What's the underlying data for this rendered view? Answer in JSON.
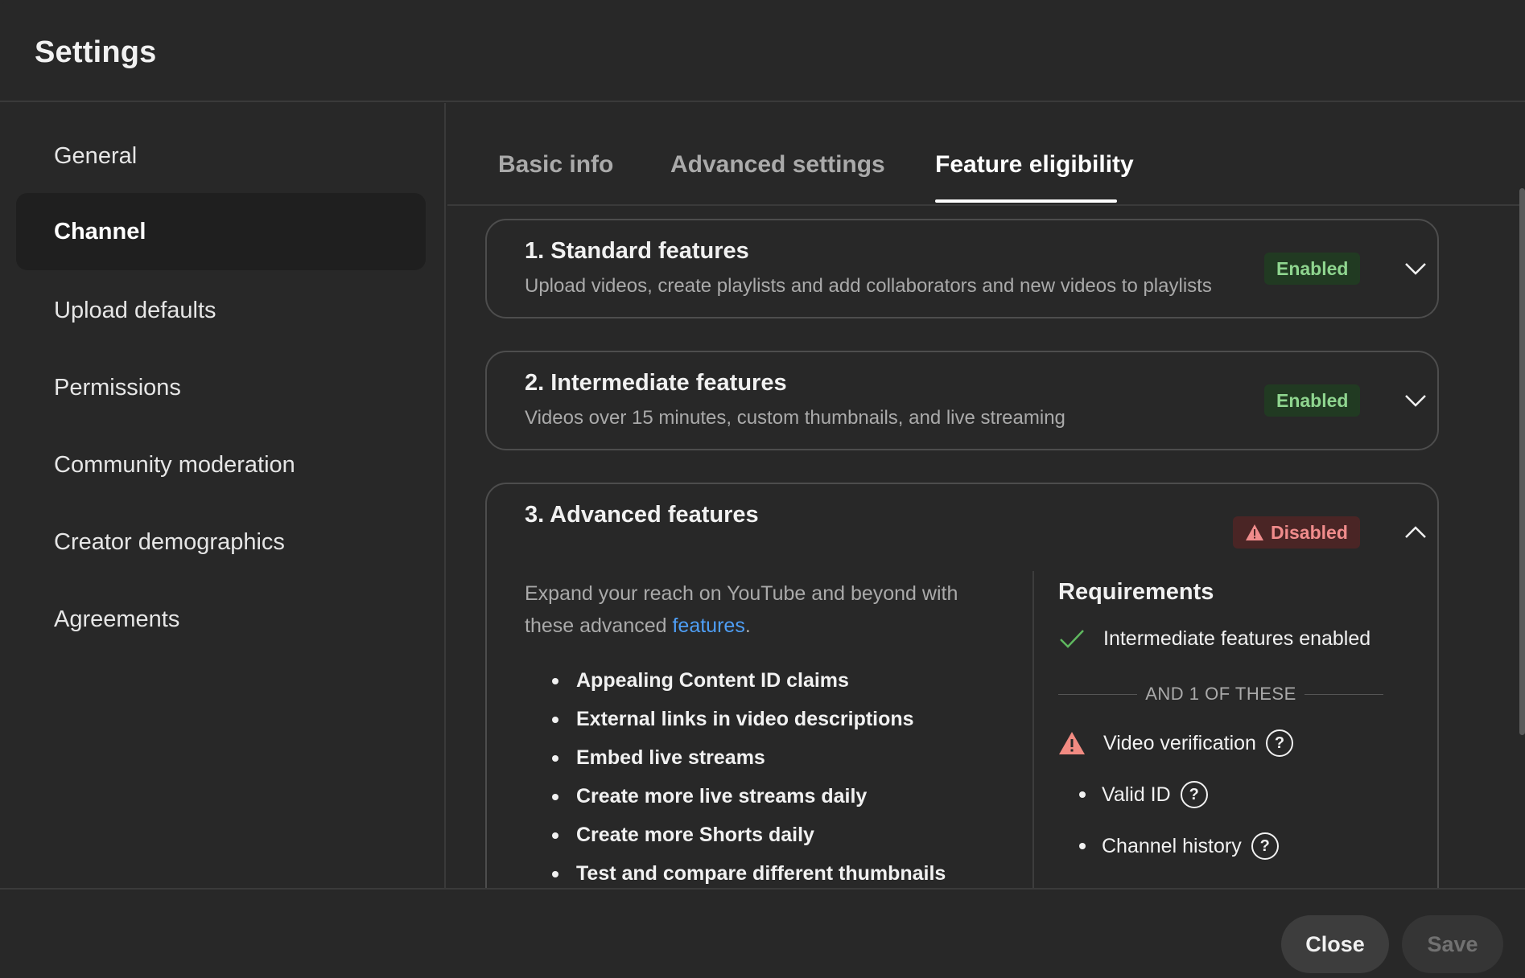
{
  "header": {
    "title": "Settings"
  },
  "sidebar": {
    "items": [
      {
        "label": "General"
      },
      {
        "label": "Channel",
        "active": true
      },
      {
        "label": "Upload defaults"
      },
      {
        "label": "Permissions"
      },
      {
        "label": "Community moderation"
      },
      {
        "label": "Creator demographics"
      },
      {
        "label": "Agreements"
      }
    ]
  },
  "tabs": [
    {
      "label": "Basic info"
    },
    {
      "label": "Advanced settings"
    },
    {
      "label": "Feature eligibility",
      "active": true
    }
  ],
  "cards": {
    "standard": {
      "title": "1. Standard features",
      "description": "Upload videos, create playlists and add collaborators and new videos to playlists",
      "status": "Enabled"
    },
    "intermediate": {
      "title": "2. Intermediate features",
      "description": "Videos over 15 minutes, custom thumbnails, and live streaming",
      "status": "Enabled"
    },
    "advanced": {
      "title": "3. Advanced features",
      "status": "Disabled",
      "description_prefix": "Expand your reach on YouTube and beyond with these advanced ",
      "description_link": "features",
      "description_suffix": ".",
      "features": [
        "Appealing Content ID claims",
        "External links in video descriptions",
        "Embed live streams",
        "Create more live streams daily",
        "Create more Shorts daily",
        "Test and compare different thumbnails"
      ],
      "requirements": {
        "title": "Requirements",
        "met": "Intermediate features enabled",
        "separator": "AND 1 OF THESE",
        "video_verification": "Video verification",
        "valid_id": "Valid ID",
        "channel_history": "Channel history"
      }
    }
  },
  "footer": {
    "close_label": "Close",
    "save_label": "Save"
  },
  "colors": {
    "background": "#282828",
    "enabled_badge_bg": "#213a22",
    "enabled_badge_text": "#8fd58f",
    "disabled_badge_bg": "#4a2525",
    "disabled_badge_text": "#f08c8c",
    "link": "#4e9ef5",
    "check": "#5fb85f",
    "warning": "#f28b82"
  },
  "icons": {
    "expand": "chevron-down-icon",
    "collapse": "chevron-up-icon",
    "met": "check-icon",
    "warning": "warning-icon",
    "help": "help-icon"
  }
}
